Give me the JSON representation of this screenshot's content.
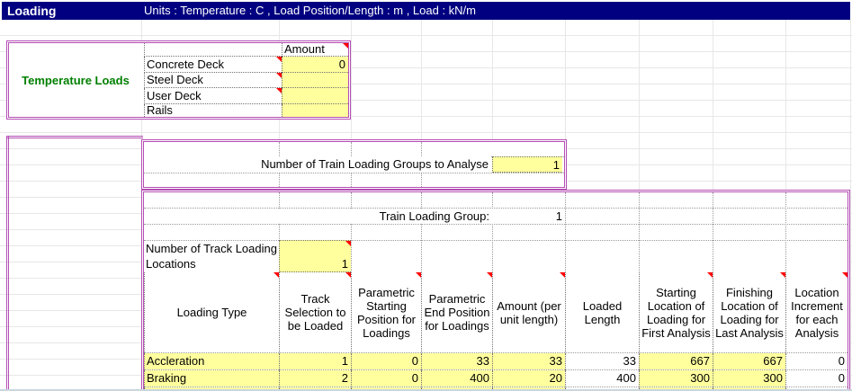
{
  "window": {
    "title": "Loading",
    "units": "Units : Temperature : C , Load Position/Length : m , Load : kN/m"
  },
  "temperature_loads": {
    "section_label": "Temperature Loads",
    "amount_header": "Amount",
    "rows": [
      {
        "label": "Concrete Deck",
        "amount": "0",
        "has_note": true
      },
      {
        "label": "Steel Deck",
        "amount": "",
        "has_note": true
      },
      {
        "label": "User Deck",
        "amount": "",
        "has_note": true
      },
      {
        "label": "Rails",
        "amount": "",
        "has_note": false
      }
    ]
  },
  "train_groups": {
    "label": "Number of Train Loading Groups to Analyse",
    "value": "1"
  },
  "train_table": {
    "group_label": "Train Loading Group:",
    "group_value": "1",
    "track_locations_label": "Number of Track Loading Locations",
    "track_locations_value": "1",
    "columns": [
      {
        "label": "Loading Type",
        "has_note": true
      },
      {
        "label": "Track Selection to be Loaded",
        "has_note": true
      },
      {
        "label": "Parametric Starting Position for Loadings",
        "has_note": true
      },
      {
        "label": "Parametric End Position for Loadings",
        "has_note": true
      },
      {
        "label": "Amount (per unit length)",
        "has_note": true
      },
      {
        "label": "Loaded Length",
        "has_note": false
      },
      {
        "label": "Starting Location of Loading for First Analysis",
        "has_note": true
      },
      {
        "label": "Finishing Location of Loading for Last Analysis",
        "has_note": true
      },
      {
        "label": "Location Increment for each Analysis",
        "has_note": true
      }
    ],
    "rows": [
      {
        "cells": [
          "Accleration",
          "1",
          "0",
          "33",
          "33",
          "33",
          "667",
          "667",
          "0"
        ]
      },
      {
        "cells": [
          "Braking",
          "2",
          "0",
          "400",
          "20",
          "400",
          "300",
          "300",
          "0"
        ]
      }
    ]
  },
  "colors": {
    "header_bg": "#000080",
    "box_border": "#b44db4",
    "input_bg": "#ffff9e",
    "section_label": "#008000",
    "note_indicator": "#ff0000"
  }
}
